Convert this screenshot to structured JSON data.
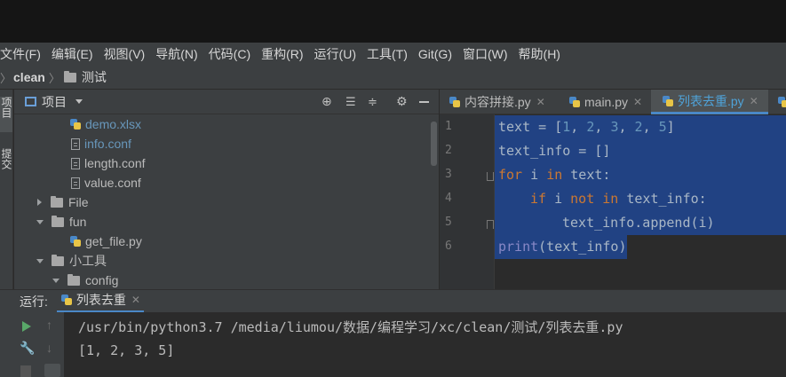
{
  "menubar": {
    "items": [
      "文件(F)",
      "编辑(E)",
      "视图(V)",
      "导航(N)",
      "代码(C)",
      "重构(R)",
      "运行(U)",
      "工具(T)",
      "Git(G)",
      "窗口(W)",
      "帮助(H)"
    ]
  },
  "navbar": {
    "project": "clean",
    "folder": "测试"
  },
  "left_strip": {
    "project_label": "项目",
    "commit_label": "提交"
  },
  "project_panel": {
    "title": "项目",
    "tree": [
      {
        "label": "demo.xlsx",
        "kind": "py-file",
        "color": "#6897bb"
      },
      {
        "label": "info.conf",
        "kind": "file",
        "color": "#6897bb"
      },
      {
        "label": "length.conf",
        "kind": "file"
      },
      {
        "label": "value.conf",
        "kind": "file"
      },
      {
        "label": "File",
        "kind": "folder-collapsed"
      },
      {
        "label": "fun",
        "kind": "folder-expanded"
      },
      {
        "label": "get_file.py",
        "kind": "py-file"
      },
      {
        "label": "小工具",
        "kind": "folder-expanded"
      },
      {
        "label": "config",
        "kind": "folder-expanded"
      }
    ]
  },
  "editor": {
    "tabs": [
      {
        "label": "内容拼接.py",
        "active": false
      },
      {
        "label": "main.py",
        "active": false
      },
      {
        "label": "列表去重.py",
        "active": true
      }
    ],
    "line_numbers": [
      "1",
      "2",
      "3",
      "4",
      "5",
      "6"
    ],
    "code": {
      "l1_a": "text = [",
      "l1_n1": "1",
      "l1_s1": ", ",
      "l1_n2": "2",
      "l1_s2": ", ",
      "l1_n3": "3",
      "l1_s3": ", ",
      "l1_n4": "2",
      "l1_s4": ", ",
      "l1_n5": "5",
      "l1_b": "]",
      "l2": "text_info = []",
      "l3_kw1": "for",
      "l3_mid": " i ",
      "l3_kw2": "in",
      "l3_end": " text:",
      "l4_kw1": "if",
      "l4_mid": " i ",
      "l4_kw2": "not in",
      "l4_end": " text_info:",
      "l5": "text_info.append(i)",
      "l6_bi": "print",
      "l6_rest": "(text_info)"
    }
  },
  "run_panel": {
    "label": "运行:",
    "tab": "列表去重",
    "console": [
      "/usr/bin/python3.7 /media/liumou/数据/编程学习/xc/clean/测试/列表去重.py",
      "[1, 2, 3, 5]"
    ]
  },
  "colors": {
    "selection": "#214283",
    "keyword": "#cc7832",
    "number": "#6897bb",
    "builtin": "#8888c6",
    "active_tab_text": "#4fa3d9",
    "run_icon": "#59a869"
  }
}
